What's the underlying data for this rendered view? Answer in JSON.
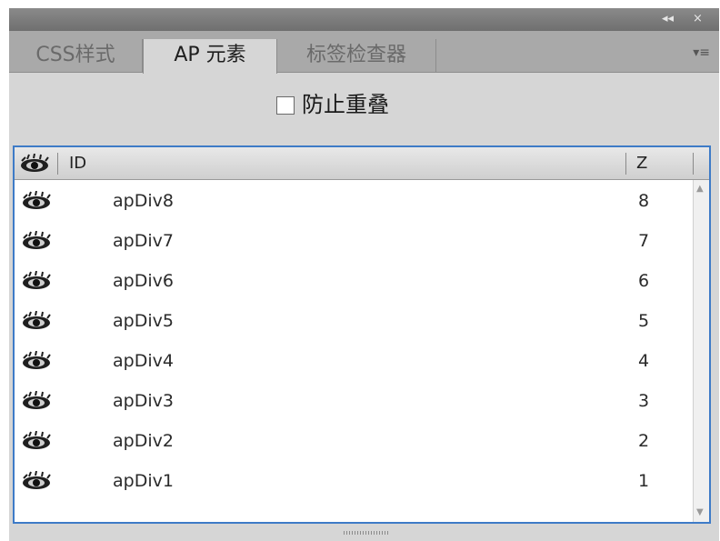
{
  "titlebar": {
    "collapse_glyph": "◂◂",
    "close_glyph": "×"
  },
  "tabs": [
    {
      "label": "CSS样式",
      "active": false
    },
    {
      "label": "AP 元素",
      "active": true
    },
    {
      "label": "标签检查器",
      "active": false
    }
  ],
  "tab_menu_glyph": "▾≡",
  "options": {
    "prevent_overlap_label": "防止重叠",
    "prevent_overlap_checked": false
  },
  "table": {
    "columns": {
      "visibility_icon": "eye-icon",
      "id": "ID",
      "z": "Z"
    },
    "rows": [
      {
        "visibility": "eye-icon",
        "id": "apDiv8",
        "z": "8"
      },
      {
        "visibility": "eye-icon",
        "id": "apDiv7",
        "z": "7"
      },
      {
        "visibility": "eye-icon",
        "id": "apDiv6",
        "z": "6"
      },
      {
        "visibility": "eye-icon",
        "id": "apDiv5",
        "z": "5"
      },
      {
        "visibility": "eye-icon",
        "id": "apDiv4",
        "z": "4"
      },
      {
        "visibility": "eye-icon",
        "id": "apDiv3",
        "z": "3"
      },
      {
        "visibility": "eye-icon",
        "id": "apDiv2",
        "z": "2"
      },
      {
        "visibility": "eye-icon",
        "id": "apDiv1",
        "z": "1"
      }
    ]
  },
  "colors": {
    "accent": "#3e7bc7",
    "panel": "#d6d6d6",
    "tabbar": "#a9a9a9"
  }
}
